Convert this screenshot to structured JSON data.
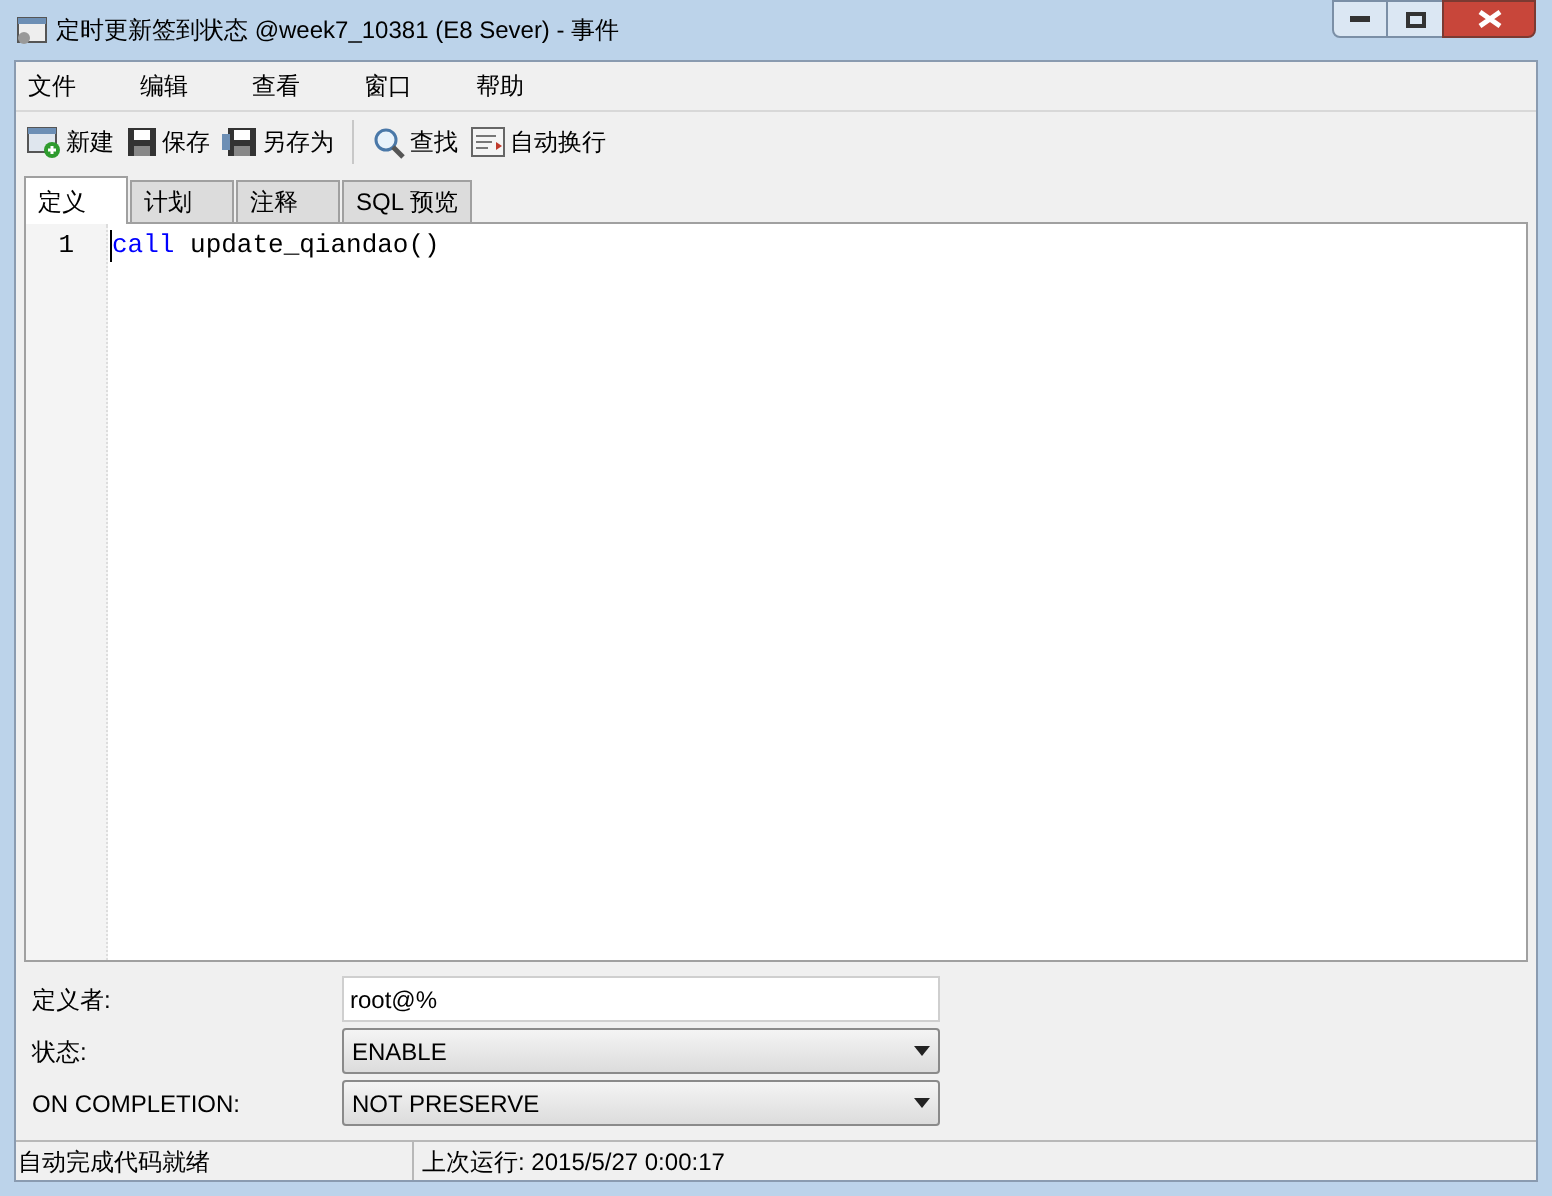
{
  "window": {
    "title": "定时更新签到状态 @week7_10381 (E8 Sever) - 事件"
  },
  "menu": [
    "文件",
    "编辑",
    "查看",
    "窗口",
    "帮助"
  ],
  "toolbar": [
    {
      "kind": "new",
      "label": "新建"
    },
    {
      "kind": "save",
      "label": "保存"
    },
    {
      "kind": "saveas",
      "label": "另存为"
    },
    {
      "kind": "separator"
    },
    {
      "kind": "find",
      "label": "查找"
    },
    {
      "kind": "wrap",
      "label": "自动换行"
    }
  ],
  "tabs": [
    {
      "label": "定义",
      "selected": true
    },
    {
      "label": "计划",
      "selected": false
    },
    {
      "label": "注释",
      "selected": false
    },
    {
      "label": "SQL 预览",
      "selected": false
    }
  ],
  "editor": {
    "lines": [
      {
        "number": "1",
        "keyword": "call",
        "rest": " update_qiandao()"
      }
    ]
  },
  "form": [
    {
      "kind": "text",
      "label": "定义者:",
      "value": "root@%"
    },
    {
      "kind": "select",
      "label": "状态:",
      "value": "ENABLE"
    },
    {
      "kind": "select",
      "label": "ON COMPLETION:",
      "value": "NOT PRESERVE"
    }
  ],
  "status_bar": [
    "自动完成代码就绪",
    "上次运行: 2015/5/27 0:00:17"
  ]
}
